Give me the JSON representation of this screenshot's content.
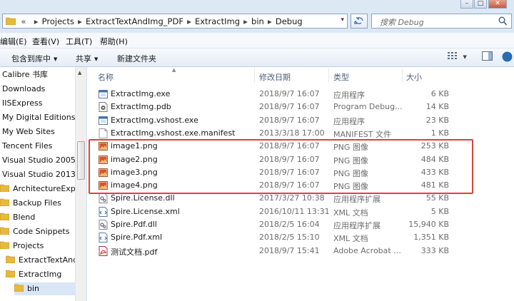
{
  "address": {
    "crumbs": [
      "Projects",
      "ExtractTextAndImg_PDF",
      "ExtractImg",
      "bin",
      "Debug"
    ],
    "lead_glyph": "«",
    "separator": "▸",
    "dropdown_glyph": "▾"
  },
  "search": {
    "placeholder": "搜索 Debug"
  },
  "window": {
    "min": "–",
    "max": "□",
    "close": "✕"
  },
  "menu": {
    "items": [
      "编辑(E)",
      "查看(V)",
      "工具(T)",
      "帮助(H)"
    ]
  },
  "toolbar": {
    "include_label": "包含到库中",
    "share_label": "共享",
    "new_folder_label": "新建文件夹",
    "caret": "▼"
  },
  "nav": {
    "items": [
      {
        "label": "Calibre 书库",
        "folder": false
      },
      {
        "label": "Downloads",
        "folder": false
      },
      {
        "label": "IISExpress",
        "folder": false
      },
      {
        "label": "My Digital Editions",
        "folder": false
      },
      {
        "label": "My Web Sites",
        "folder": false
      },
      {
        "label": "Tencent Files",
        "folder": false
      },
      {
        "label": "Visual Studio 2005",
        "folder": false
      },
      {
        "label": "Visual Studio 2013",
        "folder": false
      },
      {
        "label": "ArchitectureExplorer",
        "folder": true
      },
      {
        "label": "Backup Files",
        "folder": true
      },
      {
        "label": "Blend",
        "folder": true
      },
      {
        "label": "Code Snippets",
        "folder": true
      },
      {
        "label": "Projects",
        "folder": true
      },
      {
        "label": "ExtractTextAndImg",
        "folder": true
      },
      {
        "label": "ExtractImg",
        "folder": true
      },
      {
        "label": "bin",
        "folder": true,
        "selected": true
      }
    ]
  },
  "columns": {
    "name": "名称",
    "date": "修改日期",
    "type": "类型",
    "size": "大小"
  },
  "files": [
    {
      "name": "ExtractImg.exe",
      "date": "2018/9/7 16:07",
      "type": "应用程序",
      "size": "6 KB",
      "icon": "exe-icon"
    },
    {
      "name": "ExtractImg.pdb",
      "date": "2018/9/7 16:07",
      "type": "Program Debug...",
      "size": "14 KB",
      "icon": "pdb-icon"
    },
    {
      "name": "ExtractImg.vshost.exe",
      "date": "2018/9/7 16:07",
      "type": "应用程序",
      "size": "23 KB",
      "icon": "exe-icon"
    },
    {
      "name": "ExtractImg.vshost.exe.manifest",
      "date": "2013/3/18 17:00",
      "type": "MANIFEST 文件",
      "size": "1 KB",
      "icon": "file-icon"
    },
    {
      "name": "image1.png",
      "date": "2018/9/7 16:07",
      "type": "PNG 图像",
      "size": "253 KB",
      "icon": "png-icon"
    },
    {
      "name": "image2.png",
      "date": "2018/9/7 16:07",
      "type": "PNG 图像",
      "size": "484 KB",
      "icon": "png-icon"
    },
    {
      "name": "image3.png",
      "date": "2018/9/7 16:07",
      "type": "PNG 图像",
      "size": "433 KB",
      "icon": "png-icon"
    },
    {
      "name": "image4.png",
      "date": "2018/9/7 16:07",
      "type": "PNG 图像",
      "size": "481 KB",
      "icon": "png-icon"
    },
    {
      "name": "Spire.License.dll",
      "date": "2017/3/27 10:38",
      "type": "应用程序扩展",
      "size": "55 KB",
      "icon": "dll-icon"
    },
    {
      "name": "Spire.License.xml",
      "date": "2016/10/11 13:31",
      "type": "XML 文档",
      "size": "5 KB",
      "icon": "xml-icon"
    },
    {
      "name": "Spire.Pdf.dll",
      "date": "2018/2/5 16:04",
      "type": "应用程序扩展",
      "size": "15,940 KB",
      "icon": "dll-icon"
    },
    {
      "name": "Spire.Pdf.xml",
      "date": "2018/2/5 15:10",
      "type": "XML 文档",
      "size": "1,351 KB",
      "icon": "xml-icon"
    },
    {
      "name": "测试文档.pdf",
      "date": "2018/9/7 15:41",
      "type": "Adobe Acrobat ...",
      "size": "333 KB",
      "icon": "pdf-icon"
    }
  ],
  "colors": {
    "highlight": "#e0403d",
    "folder": "#e8b93a",
    "png": "#d6562a"
  }
}
